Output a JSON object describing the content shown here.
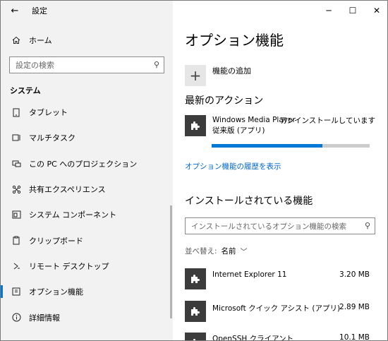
{
  "window": {
    "title": "設定",
    "minimize": "─",
    "maximize": "☐",
    "close": "✕"
  },
  "sidebar": {
    "back_icon": "back-arrow-icon",
    "home_label": "ホーム",
    "search_placeholder": "設定の検索",
    "section_label": "システム",
    "items": [
      {
        "label": "タブレット",
        "icon": "tablet-icon"
      },
      {
        "label": "マルチタスク",
        "icon": "multitask-icon"
      },
      {
        "label": "この PC へのプロジェクション",
        "icon": "projection-icon"
      },
      {
        "label": "共有エクスペリエンス",
        "icon": "shared-experience-icon"
      },
      {
        "label": "システム コンポーネント",
        "icon": "system-components-icon"
      },
      {
        "label": "クリップボード",
        "icon": "clipboard-icon"
      },
      {
        "label": "リモート デスクトップ",
        "icon": "remote-desktop-icon"
      },
      {
        "label": "オプション機能",
        "icon": "optional-features-icon",
        "active": true
      },
      {
        "label": "詳細情報",
        "icon": "info-icon"
      }
    ]
  },
  "main": {
    "title": "オプション機能",
    "add_feature_label": "機能の追加",
    "recent_actions_title": "最新のアクション",
    "recent_action": {
      "name": "Windows Media Player",
      "subtitle": "従来版 (アプリ)",
      "status": "アンインストールしています",
      "progress": 0.7
    },
    "history_link": "オプション機能の履歴を表示",
    "installed_title": "インストールされている機能",
    "installed_search_placeholder": "インストールされているオプション機能の検索",
    "sort_label": "並べ替え:",
    "sort_value": "名前",
    "installed": [
      {
        "name": "Internet Explorer 11",
        "size": "3.20 MB"
      },
      {
        "name": "Microsoft クイック アシスト (アプリ)",
        "size": "2.89 MB"
      },
      {
        "name": "OpenSSH クライアント",
        "size": "10.1 MB"
      }
    ]
  },
  "colors": {
    "accent": "#0078d7",
    "link": "#0066cc",
    "sidebar_bg": "#f2f2f2",
    "feature_icon_bg": "#3c3c3c"
  }
}
